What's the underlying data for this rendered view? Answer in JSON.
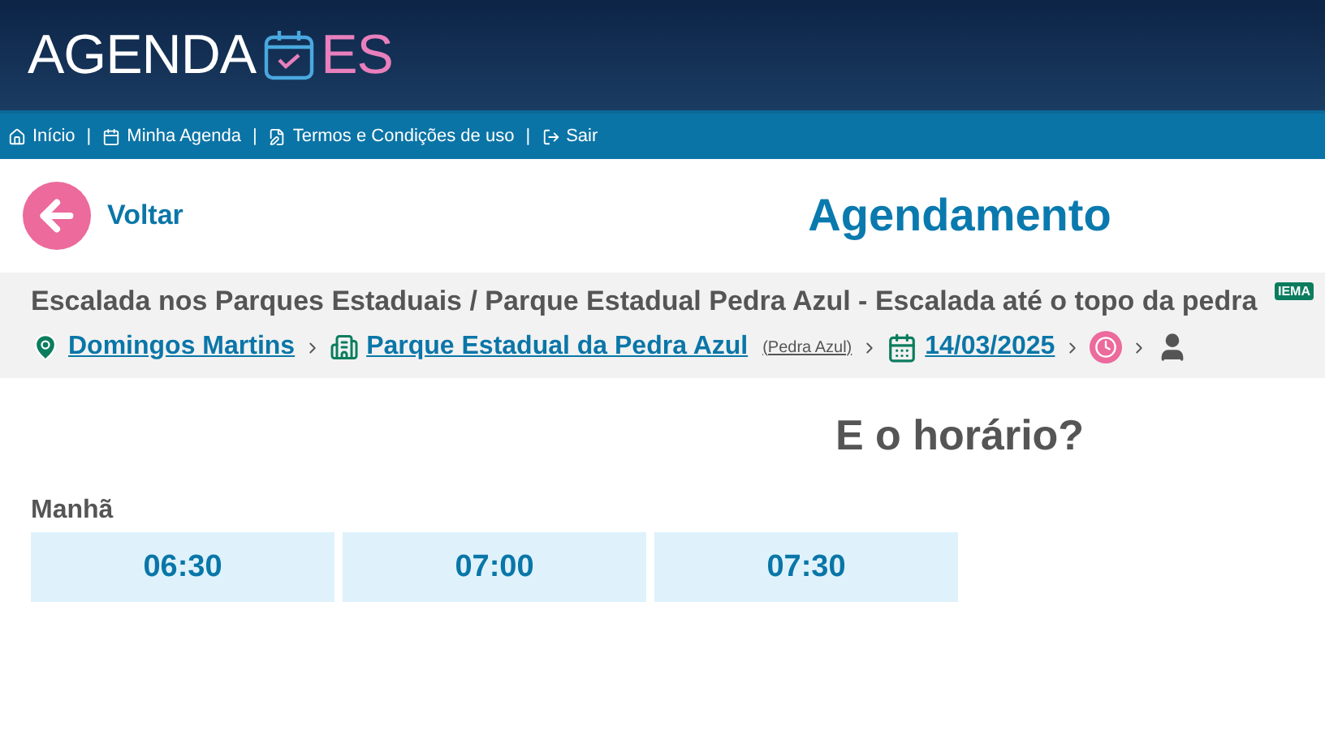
{
  "logo": {
    "word": "AGENDA",
    "suffix": "ES"
  },
  "nav": [
    {
      "label": "Início"
    },
    {
      "separator": "|",
      "label": "Minha Agenda"
    },
    {
      "separator": "|",
      "label": "Termos e Condições de uso"
    },
    {
      "separator": "|",
      "label": "Sair"
    }
  ],
  "back": {
    "label": "Voltar"
  },
  "title": "Agendamento",
  "service": {
    "name": "Escalada nos Parques Estaduais / Parque Estadual Pedra Azul - Escalada até o topo da pedra",
    "badge": "IEMA"
  },
  "breadcrumb": [
    {
      "kind": "location",
      "label": "Domingos Martins"
    },
    {
      "kind": "place",
      "label": "Parque Estadual da Pedra Azul",
      "note": "(Pedra Azul)"
    },
    {
      "kind": "date",
      "label": "14/03/2025"
    },
    {
      "kind": "time"
    },
    {
      "kind": "person"
    }
  ],
  "question": "E o horário?",
  "periods": [
    {
      "label": "Manhã",
      "slots": [
        {
          "time": "06:30",
          "selected": false
        },
        {
          "time": "07:00",
          "selected": false
        },
        {
          "time": "07:30",
          "selected": false
        }
      ]
    }
  ]
}
